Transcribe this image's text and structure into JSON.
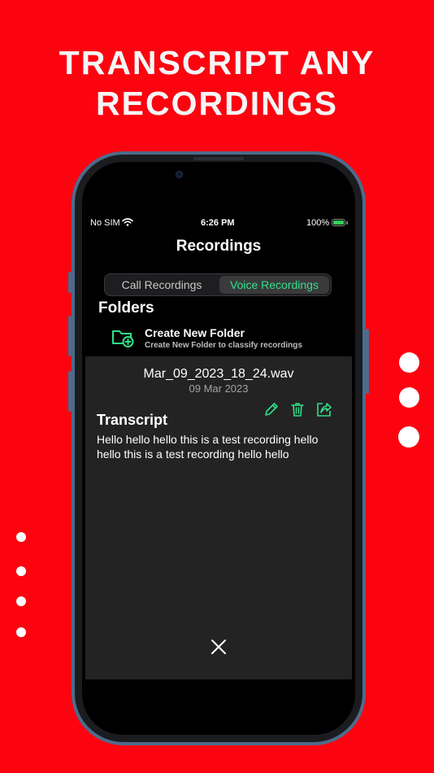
{
  "headline": [
    "TRANSCRIPT ANY",
    "RECORDINGS"
  ],
  "status_bar": {
    "carrier": "No SIM",
    "time": "6:26 PM",
    "battery": "100%"
  },
  "nav": {
    "title": "Recordings"
  },
  "tabs": [
    {
      "label": "Call Recordings",
      "selected": false
    },
    {
      "label": "Voice Recordings",
      "selected": true
    }
  ],
  "folders": {
    "title": "Folders",
    "create_title": "Create New Folder",
    "create_subtitle": "Create New Folder to classify recordings"
  },
  "sheet": {
    "file_name": "Mar_09_2023_18_24.wav",
    "date": "09 Mar 2023",
    "transcript_title": "Transcript",
    "transcript_text": "Hello hello hello this is a test recording hello hello this is a test recording hello hello",
    "actions": [
      "pencil-icon",
      "trash-icon",
      "share-icon"
    ],
    "close": "close-icon"
  },
  "colors": {
    "background": "#fb0410",
    "accent": "#31e08a",
    "sheet": "#232323"
  }
}
